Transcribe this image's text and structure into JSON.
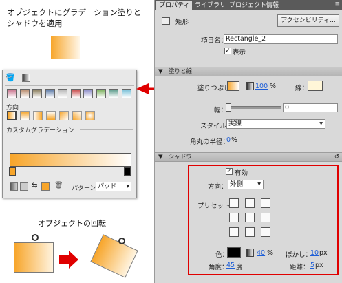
{
  "annotation": {
    "caption_line1": "オブジェクトにグラデーション塗りと",
    "caption_line2": "シャドウを適用",
    "rotate_caption": "オブジェクトの回転"
  },
  "popup": {
    "direction_label": "方向",
    "custom_label": "カスタムグラデーション",
    "pattern_label": "パターン：",
    "pattern_value": "パッド",
    "swatches": [
      "#c8728c",
      "#b88a6a",
      "#8a7d5c",
      "#5c7aa8",
      "#b8b8b8",
      "#c84848",
      "#8c8cc8",
      "#7ab05c",
      "#5c9c8c",
      "#78c0d8"
    ]
  },
  "panel": {
    "tabs": [
      "プロパティ",
      "ライブラリ",
      "プロジェクト情報"
    ],
    "shape_type": "矩形",
    "accessibility_button": "アクセシビリティ...",
    "item_name_label": "項目名：",
    "item_name_value": "Rectangle_2",
    "visible_label": "表示",
    "fill_stroke_section": "塗りと線",
    "fill_label": "塗りつぶし：",
    "fill_opacity": "100",
    "percent": "%",
    "stroke_label": "線：",
    "width_label": "幅：",
    "width_value": "0",
    "style_label": "スタイル：",
    "style_value": "実線",
    "corner_label": "角丸の半径：",
    "corner_value": "0",
    "shadow_section": "シャドウ",
    "enabled_label": "有効",
    "direction_label": "方向：",
    "direction_value": "外側",
    "preset_label": "プリセット：",
    "color_label": "色：",
    "shadow_opacity": "40",
    "blur_label": "ぼかし：",
    "blur_value": "10",
    "px": "px",
    "angle_label": "角度：",
    "angle_value": "45",
    "degree": "度",
    "distance_label": "距離：",
    "distance_value": "5"
  },
  "colors": {
    "accent_red": "#e00000",
    "orange": "#f7a52a",
    "link_blue": "#1d5ed8"
  }
}
